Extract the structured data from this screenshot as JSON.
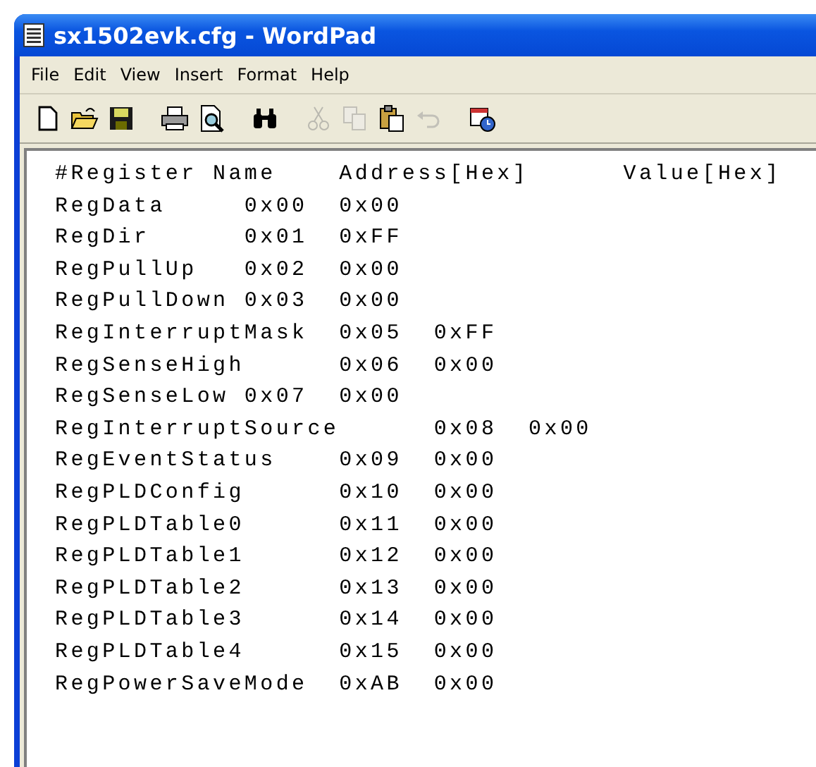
{
  "window": {
    "title": "sx1502evk.cfg - WordPad"
  },
  "menu": [
    "File",
    "Edit",
    "View",
    "Insert",
    "Format",
    "Help"
  ],
  "toolbar": [
    {
      "kind": "new",
      "disabled": false
    },
    {
      "kind": "open",
      "disabled": false
    },
    {
      "kind": "save",
      "disabled": false
    },
    {
      "kind": "sep"
    },
    {
      "kind": "print",
      "disabled": false
    },
    {
      "kind": "preview",
      "disabled": false
    },
    {
      "kind": "sep"
    },
    {
      "kind": "find",
      "disabled": false
    },
    {
      "kind": "sep"
    },
    {
      "kind": "cut",
      "disabled": true
    },
    {
      "kind": "copy",
      "disabled": true
    },
    {
      "kind": "paste",
      "disabled": false
    },
    {
      "kind": "undo",
      "disabled": true
    },
    {
      "kind": "sep"
    },
    {
      "kind": "datetime",
      "disabled": false
    }
  ],
  "document": {
    "lines": [
      "#Register Name    Address[Hex]      Value[Hex]",
      "RegData     0x00  0x00",
      "RegDir      0x01  0xFF",
      "RegPullUp   0x02  0x00",
      "RegPullDown 0x03  0x00",
      "RegInterruptMask  0x05  0xFF",
      "RegSenseHigh      0x06  0x00",
      "RegSenseLow 0x07  0x00",
      "RegInterruptSource      0x08  0x00",
      "RegEventStatus    0x09  0x00",
      "RegPLDConfig      0x10  0x00",
      "RegPLDTable0      0x11  0x00",
      "RegPLDTable1      0x12  0x00",
      "RegPLDTable2      0x13  0x00",
      "RegPLDTable3      0x14  0x00",
      "RegPLDTable4      0x15  0x00",
      "RegPowerSaveMode  0xAB  0x00"
    ]
  }
}
